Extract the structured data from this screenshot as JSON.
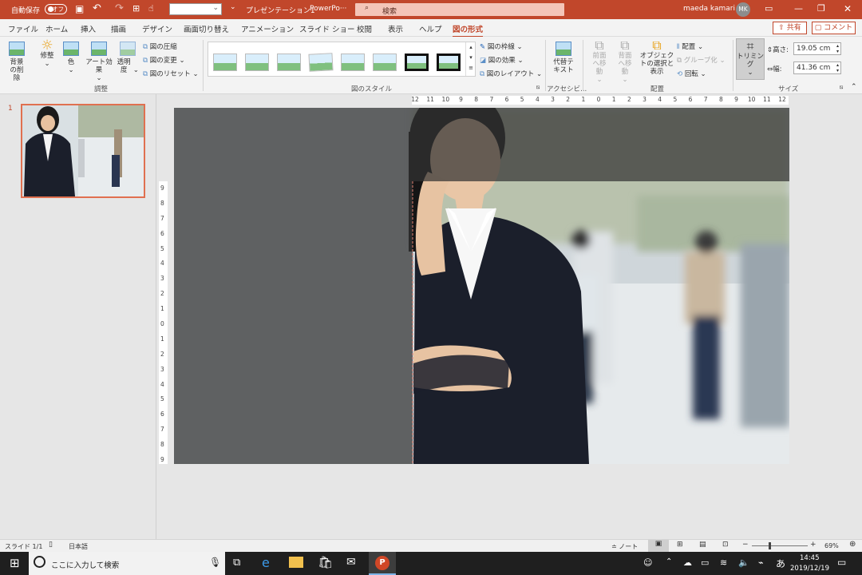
{
  "titlebar": {
    "autosave": "自動保存",
    "toggle": "オフ",
    "doc_title": "プレゼンテーション1",
    "app": "PowerPo···",
    "search": "検索",
    "user": "maeda kamari",
    "initials": "MK"
  },
  "tabs": [
    "ファイル",
    "ホーム",
    "挿入",
    "描画",
    "デザイン",
    "画面切り替え",
    "アニメーション",
    "スライド ショー",
    "校閲",
    "表示",
    "ヘルプ",
    "図の形式"
  ],
  "share": "共有",
  "comment": "コメント",
  "ribbon": {
    "adjust": {
      "remove_bg": "背景の削除",
      "corrections": "修整",
      "color": "色",
      "art": "アート効果",
      "transparency": "透明度",
      "compress": "図の圧縮",
      "change": "図の変更",
      "reset": "図のリセット",
      "group": "調整"
    },
    "styles": {
      "border": "図の枠線",
      "effects": "図の効果",
      "layout": "図のレイアウト",
      "group": "図のスタイル"
    },
    "access": {
      "alt": "代替テキスト",
      "group": "アクセシビ..."
    },
    "arrange": {
      "forward": "前面へ移動",
      "backward": "背面へ移動",
      "selection": "オブジェクトの選択と表示",
      "align": "配置",
      "grp": "グループ化",
      "rotate": "回転",
      "group": "配置"
    },
    "size": {
      "crop": "トリミング",
      "height_label": "高さ:",
      "height": "19.05 cm",
      "width_label": "幅:",
      "width": "41.36 cm",
      "group": "サイズ"
    }
  },
  "thumb_number": "1",
  "ruler_h": [
    "12",
    "11",
    "10",
    "9",
    "8",
    "7",
    "6",
    "5",
    "4",
    "3",
    "2",
    "1",
    "0",
    "1",
    "2",
    "3",
    "4",
    "5",
    "6",
    "7",
    "8",
    "9",
    "10",
    "11",
    "12"
  ],
  "ruler_v": [
    "9",
    "8",
    "7",
    "6",
    "5",
    "4",
    "3",
    "2",
    "1",
    "0",
    "1",
    "2",
    "3",
    "4",
    "5",
    "6",
    "7",
    "8",
    "9"
  ],
  "status": {
    "slide": "スライド 1/1",
    "lang": "日本語",
    "notes": "ノート",
    "zoom": "69%"
  },
  "taskbar": {
    "search": "ここに入力して検索",
    "ime": "あ",
    "time": "14:45",
    "date": "2019/12/19"
  }
}
